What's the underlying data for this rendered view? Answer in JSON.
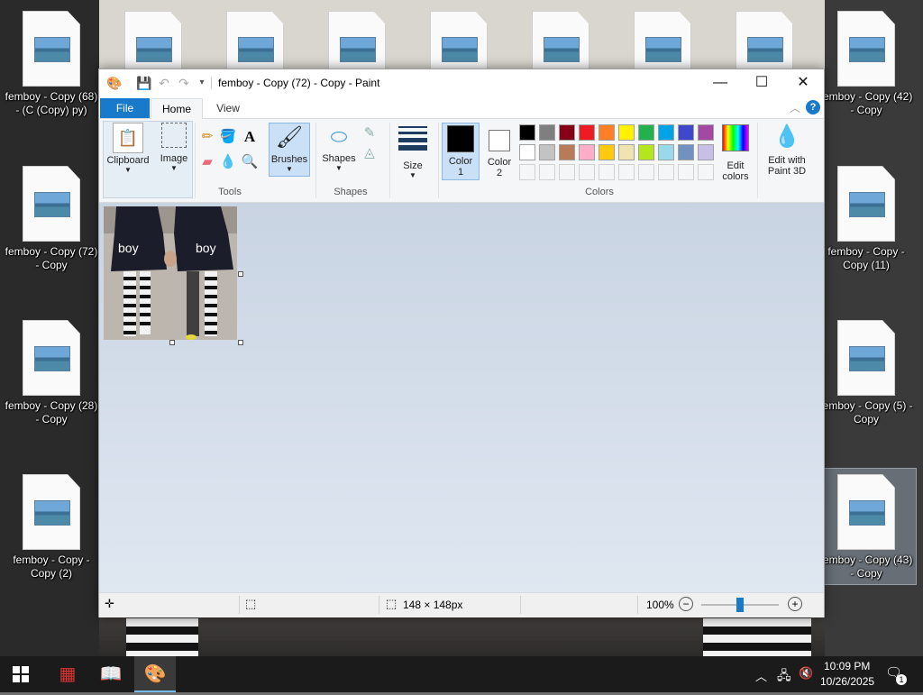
{
  "desktop": {
    "icons": [
      {
        "label": "femboy - Copy (68) - (C (Copy) py)"
      },
      {
        "label": "femboy - Copy (72) - Copy"
      },
      {
        "label": "femboy - Copy (28) - Copy"
      },
      {
        "label": "femboy - Copy - Copy (2)"
      },
      {
        "label": "femboy - Copy (42) - Copy"
      },
      {
        "label": "femboy - Copy - Copy (11)"
      },
      {
        "label": "femboy - Copy (5) - Copy"
      },
      {
        "label": "femboy - Copy (43) - Copy"
      }
    ]
  },
  "window": {
    "title": "femboy - Copy (72) - Copy - Paint",
    "controls": {
      "minimize": "—",
      "maximize": "☐",
      "close": "✕"
    }
  },
  "tabs": {
    "file": "File",
    "home": "Home",
    "view": "View"
  },
  "help_label": "?",
  "ribbon": {
    "clipboard": "Clipboard",
    "image": "Image",
    "tools": "Tools",
    "brushes": "Brushes",
    "shapes_btn": "Shapes",
    "shapes_group": "Shapes",
    "size": "Size",
    "color1": "Color\n1",
    "color1_a": "Color",
    "color1_b": "1",
    "color2_a": "Color",
    "color2_b": "2",
    "edit_colors_a": "Edit",
    "edit_colors_b": "colors",
    "paint3d_a": "Edit with",
    "paint3d_b": "Paint 3D",
    "colors_group": "Colors",
    "palette_row1": [
      "#000000",
      "#7f7f7f",
      "#880015",
      "#ed1c24",
      "#ff7f27",
      "#fff200",
      "#22b14c",
      "#00a2e8",
      "#3f48cc",
      "#a349a4"
    ],
    "palette_row2": [
      "#ffffff",
      "#c3c3c3",
      "#b97a57",
      "#ffaec9",
      "#ffc90e",
      "#efe4b0",
      "#b5e61d",
      "#99d9ea",
      "#7092be",
      "#c8bfe7"
    ]
  },
  "canvas": {
    "left_text": "boy",
    "right_text": "boy"
  },
  "status": {
    "size": "148 × 148px",
    "zoom": "100%"
  },
  "taskbar": {
    "time": "10:09 PM",
    "date": "10/26/2025",
    "notifications": "1"
  }
}
